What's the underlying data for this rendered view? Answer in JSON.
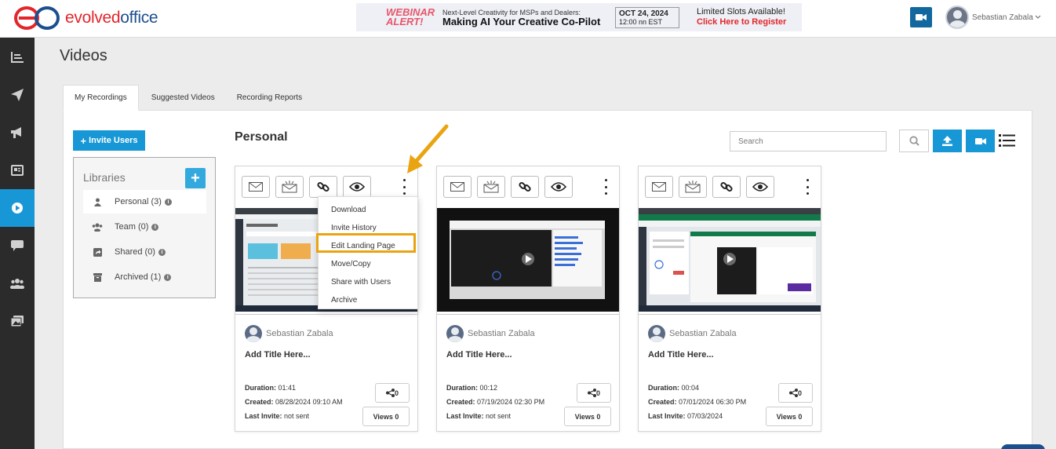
{
  "header": {
    "logo_part1": "evolved",
    "logo_part2": "office",
    "banner": {
      "alert": "WEBINAR ALERT!",
      "tagline": "Next-Level Creativity for MSPs and Dealers:",
      "headline": "Making AI Your Creative Co-Pilot",
      "date": "OCT 24, 2024",
      "time": "12:00 nn EST",
      "slots": "Limited Slots Available!",
      "cta": "Click Here to Register"
    },
    "user_name": "Sebastian Zabala"
  },
  "sidebar": {
    "items": [
      {
        "icon": "dashboard-icon",
        "active": false
      },
      {
        "icon": "send-icon",
        "active": false
      },
      {
        "icon": "megaphone-icon",
        "active": false
      },
      {
        "icon": "newspaper-icon",
        "active": false
      },
      {
        "icon": "play-circle-icon",
        "active": true
      },
      {
        "icon": "chat-icon",
        "active": false
      },
      {
        "icon": "users-icon",
        "active": false
      },
      {
        "icon": "gallery-icon",
        "active": false
      }
    ]
  },
  "page": {
    "title": "Videos",
    "tabs": [
      "My Recordings",
      "Suggested Videos",
      "Recording Reports"
    ],
    "active_tab": "My Recordings"
  },
  "libraries": {
    "invite_button": "Invite Users",
    "title": "Libraries",
    "add_button": "+",
    "items": [
      {
        "label": "Personal (3)",
        "icon": "user-icon",
        "active": true
      },
      {
        "label": "Team (0)",
        "icon": "team-icon",
        "active": false
      },
      {
        "label": "Shared (0)",
        "icon": "share-box-icon",
        "active": false
      },
      {
        "label": "Archived (1)",
        "icon": "archive-icon",
        "active": false
      }
    ]
  },
  "content": {
    "section_title": "Personal",
    "search_placeholder": "Search"
  },
  "cards": [
    {
      "author": "Sebastian Zabala",
      "title": "Add Title Here...",
      "duration_label": "Duration:",
      "duration": "01:41",
      "created_label": "Created:",
      "created": "08/28/2024 09:10 AM",
      "last_invite_label": "Last Invite:",
      "last_invite": "not sent",
      "shares": "0",
      "views": "Views 0"
    },
    {
      "author": "Sebastian Zabala",
      "title": "Add Title Here...",
      "duration_label": "Duration:",
      "duration": "00:12",
      "created_label": "Created:",
      "created": "07/19/2024 02:30 PM",
      "last_invite_label": "Last Invite:",
      "last_invite": "not sent",
      "shares": "0",
      "views": "Views 0"
    },
    {
      "author": "Sebastian Zabala",
      "title": "Add Title Here...",
      "duration_label": "Duration:",
      "duration": "00:04",
      "created_label": "Created:",
      "created": "07/01/2024 06:30 PM",
      "last_invite_label": "Last Invite:",
      "last_invite": "07/03/2024",
      "shares": "0",
      "views": "Views 0"
    }
  ],
  "dropdown": {
    "items": [
      "Download",
      "Invite History",
      "Edit Landing Page",
      "Move/Copy",
      "Share with Users",
      "Archive"
    ],
    "highlighted": "Edit Landing Page"
  },
  "colors": {
    "accent": "#1797d6",
    "sidebar_bg": "#2b2b2b",
    "highlight": "#eaa411",
    "logo_red": "#e3262b",
    "logo_blue": "#1c4f8f"
  }
}
